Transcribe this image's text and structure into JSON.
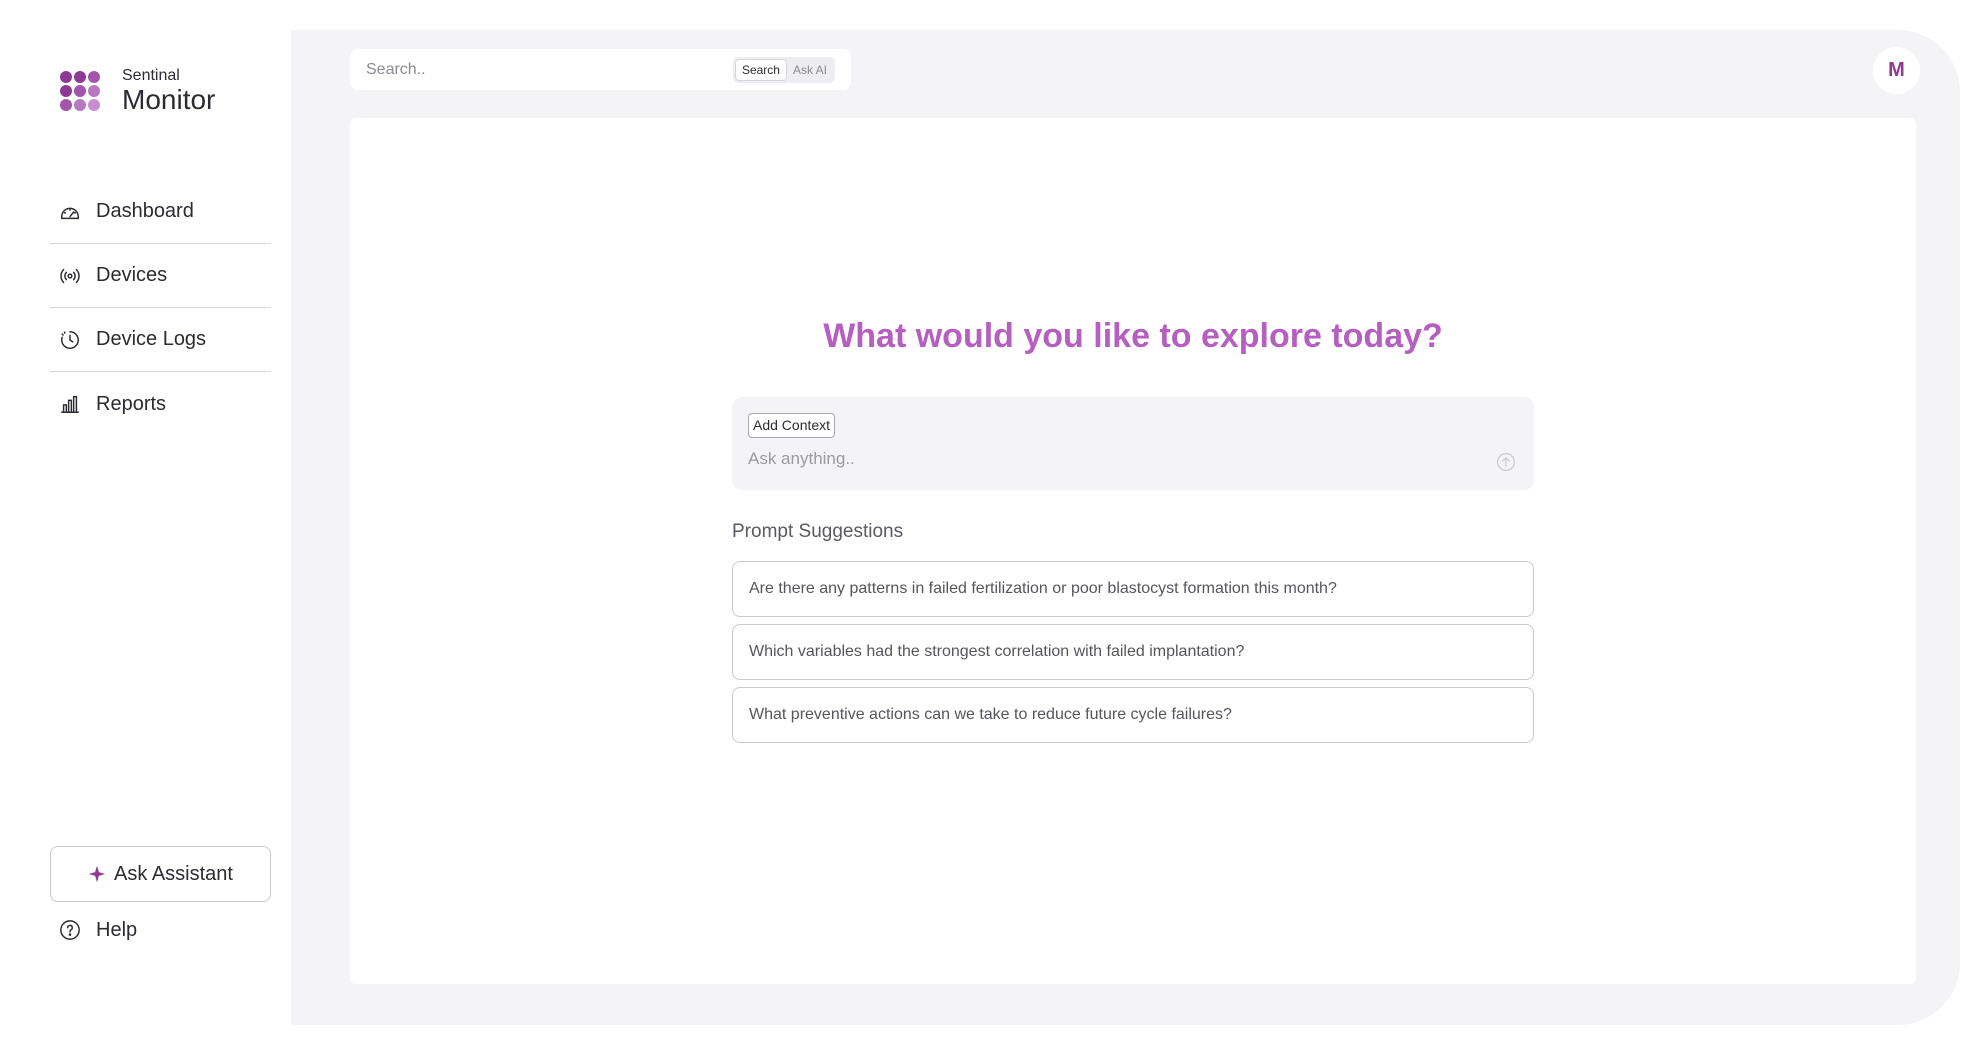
{
  "brand": {
    "subtitle": "Sentinal",
    "title": "Monitor",
    "logo_icon": "dot-grid-logo",
    "logo_colors": [
      "#8e3a95",
      "#b06cb8",
      "#c98cd0"
    ]
  },
  "sidebar": {
    "items": [
      {
        "label": "Dashboard",
        "icon": "gauge-icon"
      },
      {
        "label": "Devices",
        "icon": "broadcast-icon"
      },
      {
        "label": "Device Logs",
        "icon": "history-icon"
      },
      {
        "label": "Reports",
        "icon": "bar-chart-icon"
      }
    ],
    "assistant_label": "Ask Assistant",
    "assistant_icon": "sparkle-icon",
    "help_label": "Help",
    "help_icon": "question-circle-icon"
  },
  "topbar": {
    "search_placeholder": "Search..",
    "modes": [
      "Search",
      "Ask AI"
    ],
    "active_mode": "Search",
    "avatar_initial": "M"
  },
  "main": {
    "headline": "What would you like to explore today?",
    "add_context_label": "Add Context",
    "ask_placeholder": "Ask anything..",
    "send_icon": "arrow-up-circle-icon",
    "suggestions_title": "Prompt Suggestions",
    "suggestions": [
      "Are there any patterns in failed fertilization or poor blastocyst formation this month?",
      "Which variables had the strongest correlation with failed implantation?",
      "What preventive actions can we take to reduce future cycle failures?"
    ]
  },
  "colors": {
    "accent": "#b55fc0",
    "accent_dark": "#8e3a95",
    "background": "#f4f4f7"
  }
}
